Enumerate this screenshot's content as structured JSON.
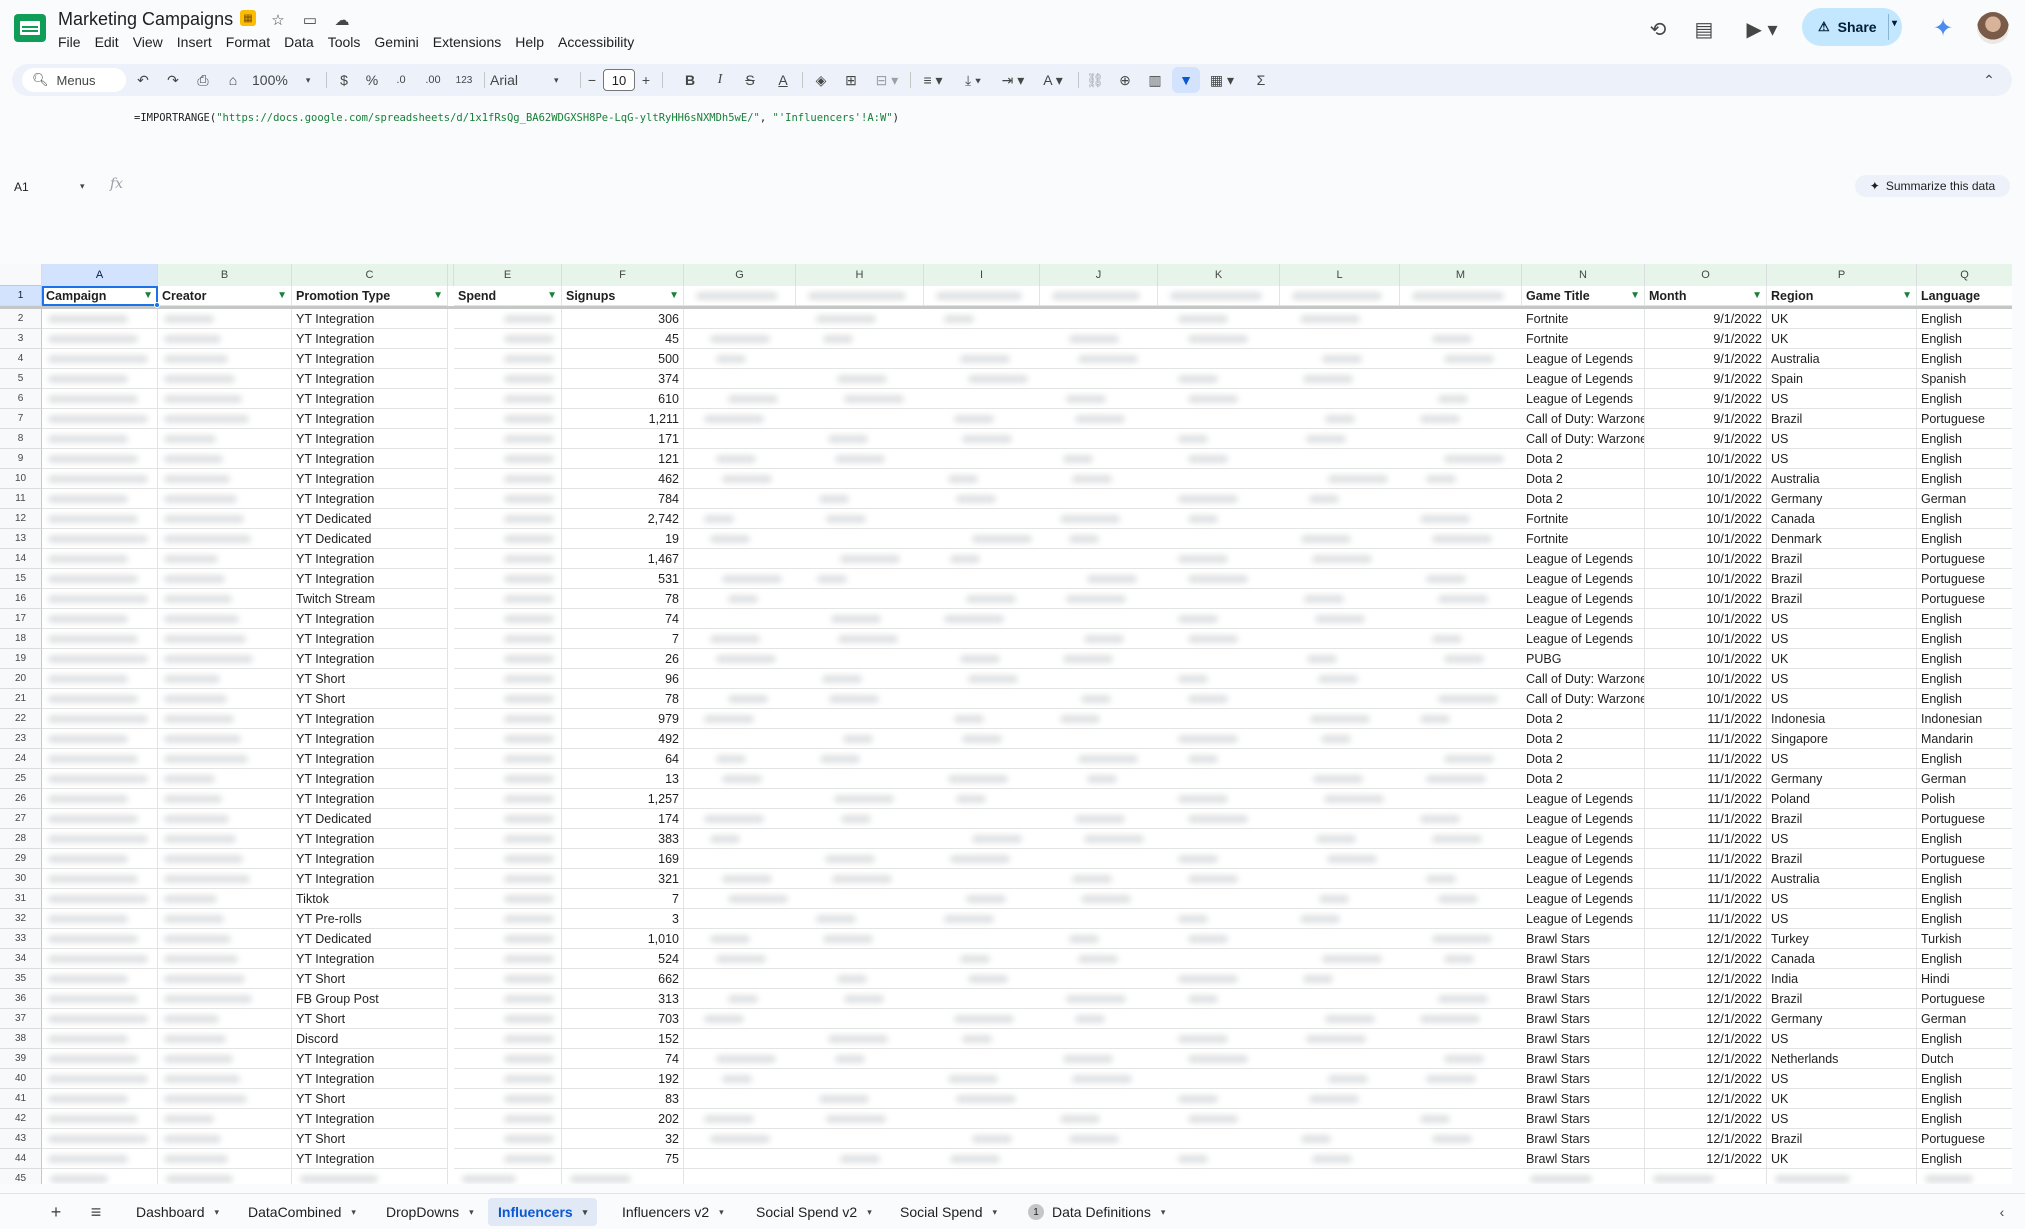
{
  "header": {
    "title": "Marketing Campaigns",
    "menu": [
      "File",
      "Edit",
      "View",
      "Insert",
      "Format",
      "Data",
      "Tools",
      "Gemini",
      "Extensions",
      "Help",
      "Accessibility"
    ],
    "share_label": "Share"
  },
  "toolbar": {
    "menus_label": "Menus",
    "zoom": "100%",
    "currency": "$",
    "percent": "%",
    "dec_decrease": ".0",
    "dec_increase": ".00",
    "format_123": "123",
    "font": "Arial",
    "font_size": "10"
  },
  "formula": {
    "prefix": "=IMPORTRANGE(",
    "url_arg": "\"https://docs.google.com/spreadsheets/d/1x1fRsQg_BA62WDGXSH8Pe-LqG-yltRyHH6sNXMDh5wE/\"",
    "sep": ", ",
    "range_arg": "\"'Influencers'!A:W\"",
    "suffix": ")"
  },
  "namebox": "A1",
  "fx_label": "fx",
  "summarize_label": "Summarize this data",
  "columns": [
    "A",
    "B",
    "C",
    "",
    "E",
    "F",
    "G",
    "H",
    "I",
    "J",
    "K",
    "L",
    "M",
    "N",
    "O",
    "P",
    "Q"
  ],
  "headers": {
    "campaign": "Campaign",
    "creator": "Creator",
    "promotion_type": "Promotion Type",
    "spend": "Spend",
    "signups": "Signups",
    "game_title": "Game Title",
    "month": "Month",
    "region": "Region",
    "language": "Language"
  },
  "rows": [
    {
      "promo": "YT Integration",
      "signups": "306",
      "game": "Fortnite",
      "month": "9/1/2022",
      "region": "UK",
      "lang": "English"
    },
    {
      "promo": "YT Integration",
      "signups": "45",
      "game": "Fortnite",
      "month": "9/1/2022",
      "region": "UK",
      "lang": "English"
    },
    {
      "promo": "YT Integration",
      "signups": "500",
      "game": "League of Legends",
      "month": "9/1/2022",
      "region": "Australia",
      "lang": "English"
    },
    {
      "promo": "YT Integration",
      "signups": "374",
      "game": "League of Legends",
      "month": "9/1/2022",
      "region": "Spain",
      "lang": "Spanish"
    },
    {
      "promo": "YT Integration",
      "signups": "610",
      "game": "League of Legends",
      "month": "9/1/2022",
      "region": "US",
      "lang": "English"
    },
    {
      "promo": "YT Integration",
      "signups": "1,211",
      "game": "Call of Duty: Warzone",
      "month": "9/1/2022",
      "region": "Brazil",
      "lang": "Portuguese"
    },
    {
      "promo": "YT Integration",
      "signups": "171",
      "game": "Call of Duty: Warzone",
      "month": "9/1/2022",
      "region": "US",
      "lang": "English"
    },
    {
      "promo": "YT Integration",
      "signups": "121",
      "game": "Dota 2",
      "month": "10/1/2022",
      "region": "US",
      "lang": "English"
    },
    {
      "promo": "YT Integration",
      "signups": "462",
      "game": "Dota 2",
      "month": "10/1/2022",
      "region": "Australia",
      "lang": "English"
    },
    {
      "promo": "YT Integration",
      "signups": "784",
      "game": "Dota 2",
      "month": "10/1/2022",
      "region": "Germany",
      "lang": "German"
    },
    {
      "promo": "YT Dedicated",
      "signups": "2,742",
      "game": "Fortnite",
      "month": "10/1/2022",
      "region": "Canada",
      "lang": "English"
    },
    {
      "promo": "YT Dedicated",
      "signups": "19",
      "game": "Fortnite",
      "month": "10/1/2022",
      "region": "Denmark",
      "lang": "English"
    },
    {
      "promo": "YT Integration",
      "signups": "1,467",
      "game": "League of Legends",
      "month": "10/1/2022",
      "region": "Brazil",
      "lang": "Portuguese"
    },
    {
      "promo": "YT Integration",
      "signups": "531",
      "game": "League of Legends",
      "month": "10/1/2022",
      "region": "Brazil",
      "lang": "Portuguese"
    },
    {
      "promo": "Twitch Stream",
      "signups": "78",
      "game": "League of Legends",
      "month": "10/1/2022",
      "region": "Brazil",
      "lang": "Portuguese"
    },
    {
      "promo": "YT Integration",
      "signups": "74",
      "game": "League of Legends",
      "month": "10/1/2022",
      "region": "US",
      "lang": "English"
    },
    {
      "promo": "YT Integration",
      "signups": "7",
      "game": "League of Legends",
      "month": "10/1/2022",
      "region": "US",
      "lang": "English"
    },
    {
      "promo": "YT Integration",
      "signups": "26",
      "game": "PUBG",
      "month": "10/1/2022",
      "region": "UK",
      "lang": "English"
    },
    {
      "promo": "YT Short",
      "signups": "96",
      "game": "Call of Duty: Warzone",
      "month": "10/1/2022",
      "region": "US",
      "lang": "English"
    },
    {
      "promo": "YT Short",
      "signups": "78",
      "game": "Call of Duty: Warzone",
      "month": "10/1/2022",
      "region": "US",
      "lang": "English"
    },
    {
      "promo": "YT Integration",
      "signups": "979",
      "game": "Dota 2",
      "month": "11/1/2022",
      "region": "Indonesia",
      "lang": "Indonesian"
    },
    {
      "promo": "YT Integration",
      "signups": "492",
      "game": "Dota 2",
      "month": "11/1/2022",
      "region": "Singapore",
      "lang": "Mandarin"
    },
    {
      "promo": "YT Integration",
      "signups": "64",
      "game": "Dota 2",
      "month": "11/1/2022",
      "region": "US",
      "lang": "English"
    },
    {
      "promo": "YT Integration",
      "signups": "13",
      "game": "Dota 2",
      "month": "11/1/2022",
      "region": "Germany",
      "lang": "German"
    },
    {
      "promo": "YT Integration",
      "signups": "1,257",
      "game": "League of Legends",
      "month": "11/1/2022",
      "region": "Poland",
      "lang": "Polish"
    },
    {
      "promo": "YT Dedicated",
      "signups": "174",
      "game": "League of Legends",
      "month": "11/1/2022",
      "region": "Brazil",
      "lang": "Portuguese"
    },
    {
      "promo": "YT Integration",
      "signups": "383",
      "game": "League of Legends",
      "month": "11/1/2022",
      "region": "US",
      "lang": "English"
    },
    {
      "promo": "YT Integration",
      "signups": "169",
      "game": "League of Legends",
      "month": "11/1/2022",
      "region": "Brazil",
      "lang": "Portuguese"
    },
    {
      "promo": "YT Integration",
      "signups": "321",
      "game": "League of Legends",
      "month": "11/1/2022",
      "region": "Australia",
      "lang": "English"
    },
    {
      "promo": "Tiktok",
      "signups": "7",
      "game": "League of Legends",
      "month": "11/1/2022",
      "region": "US",
      "lang": "English"
    },
    {
      "promo": "YT Pre-rolls",
      "signups": "3",
      "game": "League of Legends",
      "month": "11/1/2022",
      "region": "US",
      "lang": "English"
    },
    {
      "promo": "YT Dedicated",
      "signups": "1,010",
      "game": "Brawl Stars",
      "month": "12/1/2022",
      "region": "Turkey",
      "lang": "Turkish"
    },
    {
      "promo": "YT Integration",
      "signups": "524",
      "game": "Brawl Stars",
      "month": "12/1/2022",
      "region": "Canada",
      "lang": "English"
    },
    {
      "promo": "YT Short",
      "signups": "662",
      "game": "Brawl Stars",
      "month": "12/1/2022",
      "region": "India",
      "lang": "Hindi"
    },
    {
      "promo": "FB Group Post",
      "signups": "313",
      "game": "Brawl Stars",
      "month": "12/1/2022",
      "region": "Brazil",
      "lang": "Portuguese"
    },
    {
      "promo": "YT Short",
      "signups": "703",
      "game": "Brawl Stars",
      "month": "12/1/2022",
      "region": "Germany",
      "lang": "German"
    },
    {
      "promo": "Discord",
      "signups": "152",
      "game": "Brawl Stars",
      "month": "12/1/2022",
      "region": "US",
      "lang": "English"
    },
    {
      "promo": "YT Integration",
      "signups": "74",
      "game": "Brawl Stars",
      "month": "12/1/2022",
      "region": "Netherlands",
      "lang": "Dutch"
    },
    {
      "promo": "YT Integration",
      "signups": "192",
      "game": "Brawl Stars",
      "month": "12/1/2022",
      "region": "US",
      "lang": "English"
    },
    {
      "promo": "YT Short",
      "signups": "83",
      "game": "Brawl Stars",
      "month": "12/1/2022",
      "region": "UK",
      "lang": "English"
    },
    {
      "promo": "YT Integration",
      "signups": "202",
      "game": "Brawl Stars",
      "month": "12/1/2022",
      "region": "US",
      "lang": "English"
    },
    {
      "promo": "YT Short",
      "signups": "32",
      "game": "Brawl Stars",
      "month": "12/1/2022",
      "region": "Brazil",
      "lang": "Portuguese"
    },
    {
      "promo": "YT Integration",
      "signups": "75",
      "game": "Brawl Stars",
      "month": "12/1/2022",
      "region": "UK",
      "lang": "English"
    }
  ],
  "sheets": [
    {
      "name": "Dashboard",
      "active": false
    },
    {
      "name": "DataCombined",
      "active": false
    },
    {
      "name": "DropDowns",
      "active": false
    },
    {
      "name": "Influencers",
      "active": true
    },
    {
      "name": "Influencers v2",
      "active": false
    },
    {
      "name": "Social Spend v2",
      "active": false
    },
    {
      "name": "Social Spend",
      "active": false
    },
    {
      "name": "Data Definitions",
      "active": false,
      "badge": "1"
    }
  ],
  "colors": {
    "accent": "#1a73e8",
    "share_bg": "#c2e7ff",
    "filter_green": "#188038"
  }
}
